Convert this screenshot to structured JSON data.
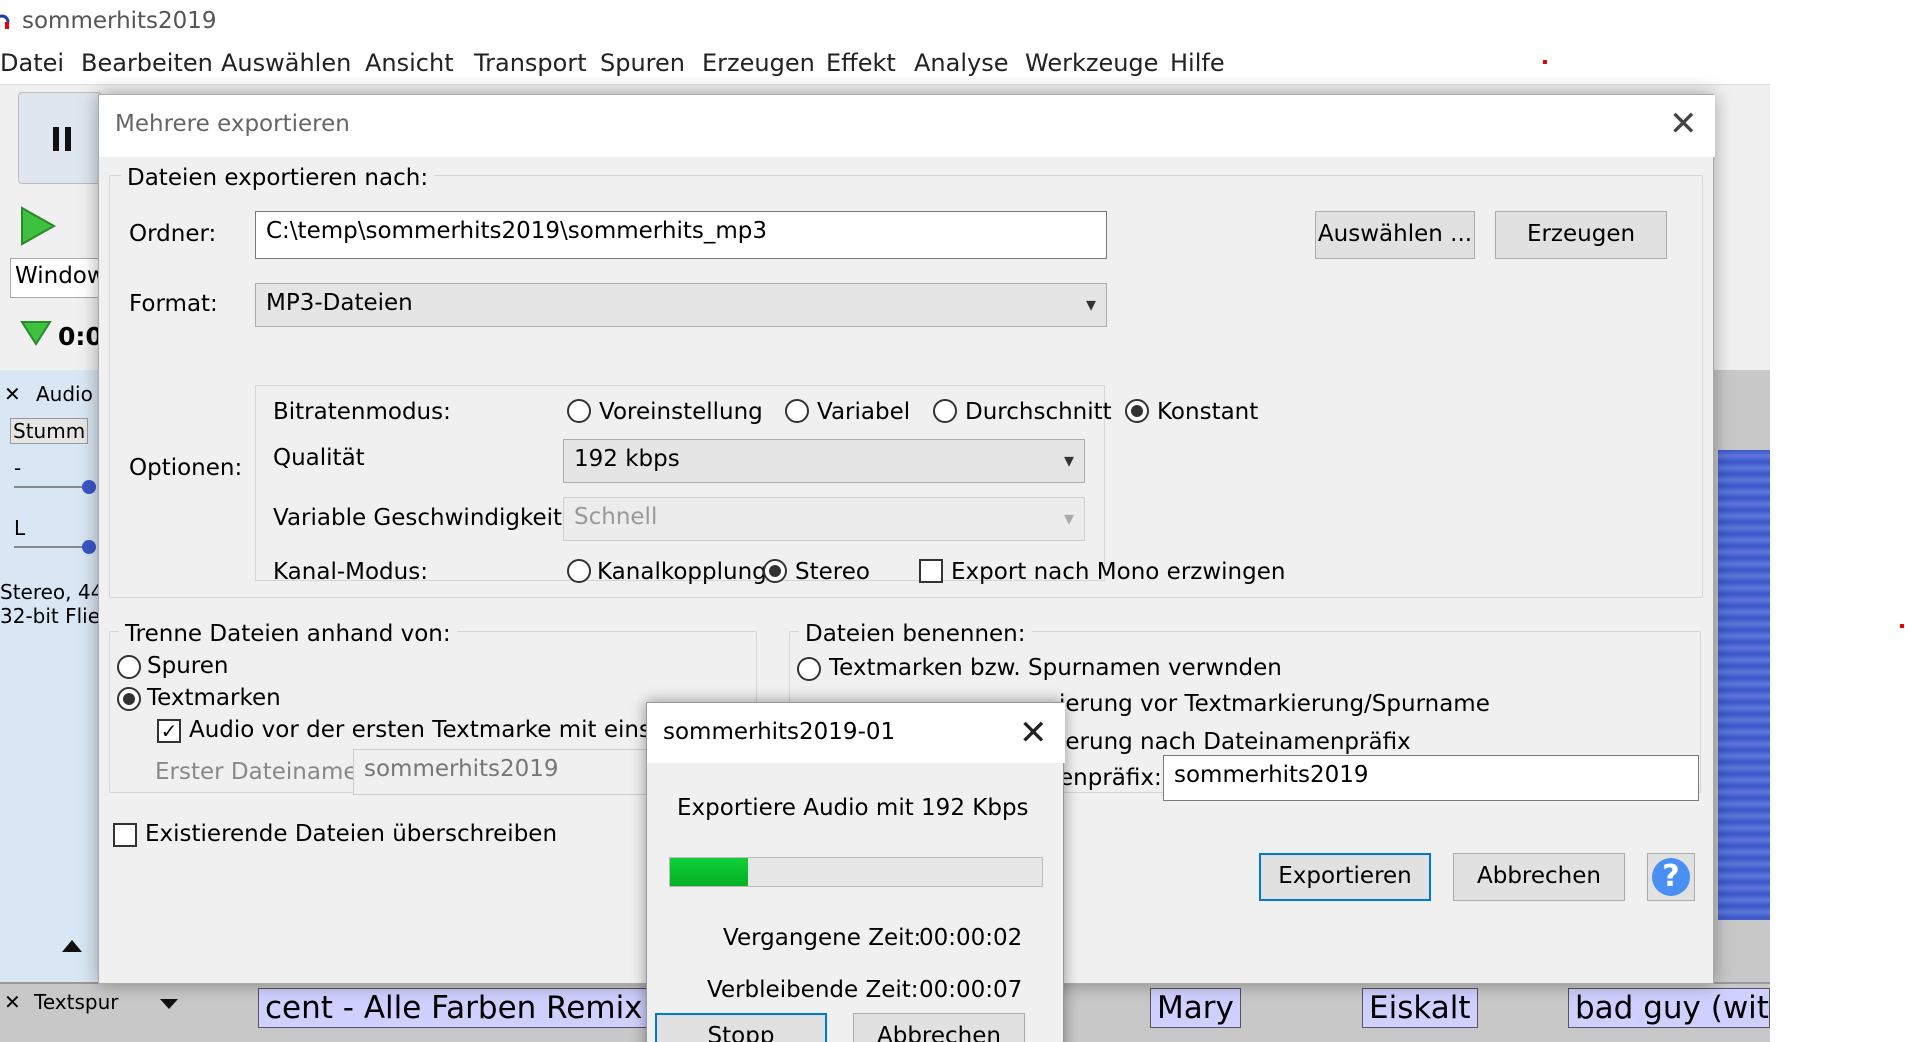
{
  "app": {
    "title": "sommerhits2019",
    "menu": [
      "Datei",
      "Bearbeiten",
      "Auswählen",
      "Ansicht",
      "Transport",
      "Spuren",
      "Erzeugen",
      "Effekt",
      "Analyse",
      "Werkzeuge",
      "Hilfe"
    ],
    "device_dropdown": "Window",
    "timer": "0:0",
    "track_name": "Audio",
    "mute_label": "Stumm",
    "gain_label": "-",
    "pan_label": "L",
    "track_info_1": "Stereo, 44",
    "track_info_2": "32-bit Flie",
    "label_track_name": "Textspur",
    "labels": [
      "cent - Alle Farben Remix",
      "Mary",
      "Eiskalt",
      "bad guy (with"
    ]
  },
  "dialog": {
    "title": "Mehrere exportieren",
    "export_to": {
      "group_title": "Dateien exportieren nach:",
      "folder_label": "Ordner:",
      "folder_value": "C:\\temp\\sommerhits2019\\sommerhits_mp3",
      "choose_button": "Auswählen ...",
      "create_button": "Erzeugen",
      "format_label": "Format:",
      "format_value": "MP3-Dateien",
      "options_label": "Optionen:",
      "bitrate_label": "Bitratenmodus:",
      "bitrate_modes": [
        "Voreinstellung",
        "Variabel",
        "Durchschnitt",
        "Konstant"
      ],
      "bitrate_selected": "Konstant",
      "quality_label": "Qualität",
      "quality_value": "192 kbps",
      "vbr_label": "Variable Geschwindigkeit:",
      "vbr_value": "Schnell",
      "channel_label": "Kanal-Modus:",
      "channel_modes": [
        "Kanalkopplung",
        "Stereo"
      ],
      "channel_selected": "Stereo",
      "force_mono_label": "Export nach Mono erzwingen"
    },
    "split": {
      "group_title": "Trenne Dateien anhand von:",
      "tracks_label": "Spuren",
      "labels_label": "Textmarken",
      "selected": "Textmarken",
      "include_audio_label": "Audio vor der ersten Textmarke mit einschli",
      "first_filename_label": "Erster Dateiname:",
      "first_filename_value": "sommerhits2019"
    },
    "naming": {
      "group_title": "Dateien benennen:",
      "option1": "Textmarken bzw. Spurnamen verwnden",
      "option2": "ierung vor Textmarkierung/Spurname",
      "option3": "ierung nach Dateinamenpräfix",
      "prefix_label": "enpräfix:",
      "prefix_value": "sommerhits2019"
    },
    "overwrite_label": "Existierende Dateien überschreiben",
    "export_button": "Exportieren",
    "cancel_button": "Abbrechen",
    "help_button": "?"
  },
  "progress": {
    "title": "sommerhits2019-01",
    "message": "Exportiere Audio mit 192 Kbps",
    "percent": 21,
    "elapsed_label": "Vergangene Zeit:",
    "elapsed_value": "00:00:02",
    "remaining_label": "Verbleibende Zeit:",
    "remaining_value": "00:00:07",
    "stop_button": "Stopp",
    "cancel_button": "Abbrechen"
  }
}
